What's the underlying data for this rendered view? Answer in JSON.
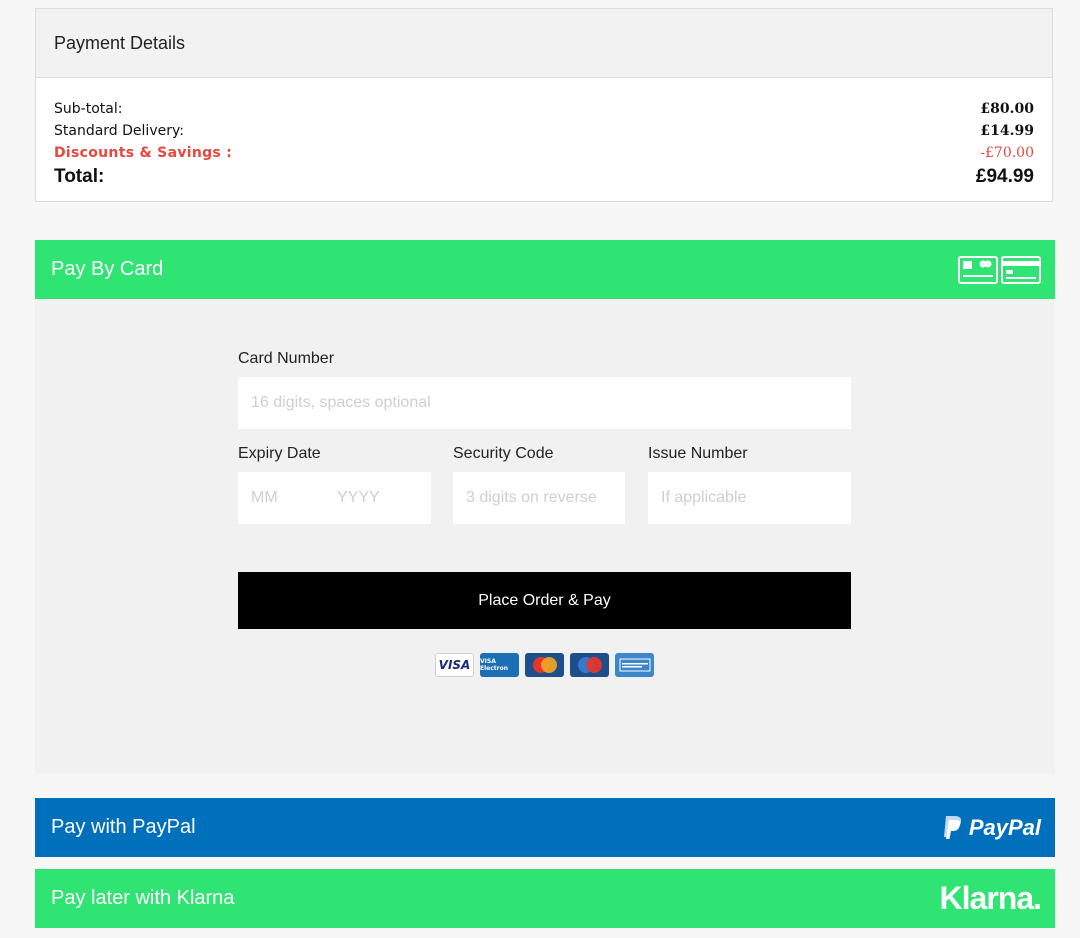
{
  "summary": {
    "title": "Payment Details",
    "subtotal_label": "Sub-total:",
    "subtotal_value": "£80.00",
    "delivery_label": "Standard Delivery:",
    "delivery_value": "£14.99",
    "discount_label": "Discounts & Savings :",
    "discount_value": "-£70.00",
    "total_label": "Total:",
    "total_value": "£94.99"
  },
  "card": {
    "header": "Pay By Card",
    "card_number_label": "Card Number",
    "card_number_placeholder": "16 digits, spaces optional",
    "expiry_label": "Expiry Date",
    "expiry_month_placeholder": "MM",
    "expiry_year_placeholder": "YYYY",
    "security_label": "Security Code",
    "security_placeholder": "3 digits on reverse",
    "issue_label": "Issue Number",
    "issue_placeholder": "If applicable",
    "submit_label": "Place Order & Pay",
    "brands": [
      "VISA",
      "VISA Electron",
      "MasterCard",
      "Maestro",
      "American Express"
    ]
  },
  "paypal": {
    "header": "Pay with PayPal",
    "logo_text": "PayPal"
  },
  "klarna": {
    "header": "Pay later with Klarna",
    "logo_text": "Klarna."
  },
  "colors": {
    "green": "#30e473",
    "paypal_blue": "#006fbc",
    "discount_red": "#e8473f"
  }
}
